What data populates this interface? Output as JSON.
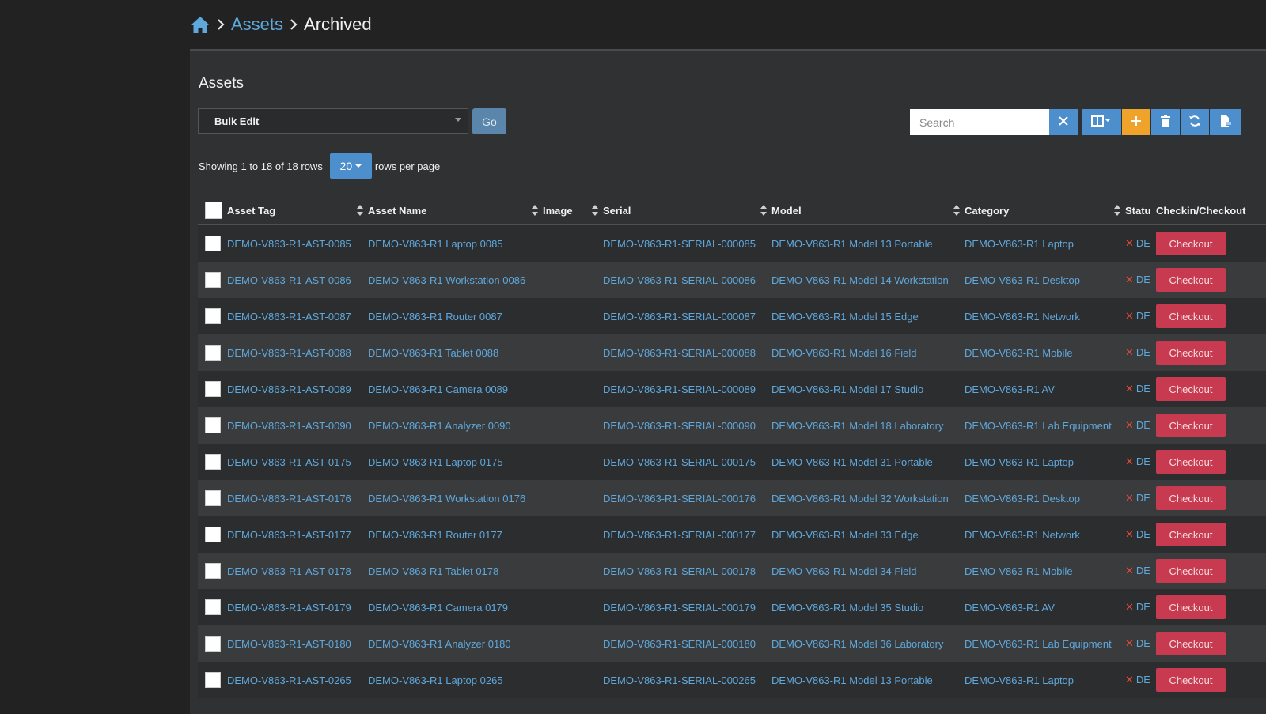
{
  "breadcrumb": {
    "home_icon": "home-icon",
    "items": [
      {
        "label": "Assets",
        "link": true
      },
      {
        "label": "Archived",
        "link": false
      }
    ]
  },
  "panel": {
    "title": "Assets",
    "bulk": {
      "selected": "Bulk Edit",
      "go_label": "Go"
    },
    "search": {
      "placeholder": "Search"
    },
    "toolbar": {
      "clear_icon": "close-icon",
      "columns_icon": "columns-icon",
      "add_icon": "plus-icon",
      "delete_icon": "trash-icon",
      "refresh_icon": "refresh-icon",
      "export_icon": "export-file-icon"
    },
    "pager": {
      "showing": "Showing 1 to 18 of 18 rows",
      "per_page_value": "20",
      "per_page_suffix": "rows per page"
    },
    "colors": {
      "link": "#5fa8dc",
      "accent": "#4d8fcd",
      "warning": "#f0a32a",
      "danger": "#c83a4f"
    }
  },
  "table": {
    "columns": [
      "Asset Tag",
      "Asset Name",
      "Image",
      "Serial",
      "Model",
      "Category",
      "Statu",
      "Checkin/Checkout"
    ],
    "status_label": "DE",
    "checkout_label": "Checkout",
    "rows": [
      {
        "tag": "DEMO-V863-R1-AST-0085",
        "name": "DEMO-V863-R1 Laptop 0085",
        "serial": "DEMO-V863-R1-SERIAL-000085",
        "model": "DEMO-V863-R1 Model 13 Portable",
        "category": "DEMO-V863-R1 Laptop"
      },
      {
        "tag": "DEMO-V863-R1-AST-0086",
        "name": "DEMO-V863-R1 Workstation 0086",
        "serial": "DEMO-V863-R1-SERIAL-000086",
        "model": "DEMO-V863-R1 Model 14 Workstation",
        "category": "DEMO-V863-R1 Desktop"
      },
      {
        "tag": "DEMO-V863-R1-AST-0087",
        "name": "DEMO-V863-R1 Router 0087",
        "serial": "DEMO-V863-R1-SERIAL-000087",
        "model": "DEMO-V863-R1 Model 15 Edge",
        "category": "DEMO-V863-R1 Network"
      },
      {
        "tag": "DEMO-V863-R1-AST-0088",
        "name": "DEMO-V863-R1 Tablet 0088",
        "serial": "DEMO-V863-R1-SERIAL-000088",
        "model": "DEMO-V863-R1 Model 16 Field",
        "category": "DEMO-V863-R1 Mobile"
      },
      {
        "tag": "DEMO-V863-R1-AST-0089",
        "name": "DEMO-V863-R1 Camera 0089",
        "serial": "DEMO-V863-R1-SERIAL-000089",
        "model": "DEMO-V863-R1 Model 17 Studio",
        "category": "DEMO-V863-R1 AV"
      },
      {
        "tag": "DEMO-V863-R1-AST-0090",
        "name": "DEMO-V863-R1 Analyzer 0090",
        "serial": "DEMO-V863-R1-SERIAL-000090",
        "model": "DEMO-V863-R1 Model 18 Laboratory",
        "category": "DEMO-V863-R1 Lab Equipment"
      },
      {
        "tag": "DEMO-V863-R1-AST-0175",
        "name": "DEMO-V863-R1 Laptop 0175",
        "serial": "DEMO-V863-R1-SERIAL-000175",
        "model": "DEMO-V863-R1 Model 31 Portable",
        "category": "DEMO-V863-R1 Laptop"
      },
      {
        "tag": "DEMO-V863-R1-AST-0176",
        "name": "DEMO-V863-R1 Workstation 0176",
        "serial": "DEMO-V863-R1-SERIAL-000176",
        "model": "DEMO-V863-R1 Model 32 Workstation",
        "category": "DEMO-V863-R1 Desktop"
      },
      {
        "tag": "DEMO-V863-R1-AST-0177",
        "name": "DEMO-V863-R1 Router 0177",
        "serial": "DEMO-V863-R1-SERIAL-000177",
        "model": "DEMO-V863-R1 Model 33 Edge",
        "category": "DEMO-V863-R1 Network"
      },
      {
        "tag": "DEMO-V863-R1-AST-0178",
        "name": "DEMO-V863-R1 Tablet 0178",
        "serial": "DEMO-V863-R1-SERIAL-000178",
        "model": "DEMO-V863-R1 Model 34 Field",
        "category": "DEMO-V863-R1 Mobile"
      },
      {
        "tag": "DEMO-V863-R1-AST-0179",
        "name": "DEMO-V863-R1 Camera 0179",
        "serial": "DEMO-V863-R1-SERIAL-000179",
        "model": "DEMO-V863-R1 Model 35 Studio",
        "category": "DEMO-V863-R1 AV"
      },
      {
        "tag": "DEMO-V863-R1-AST-0180",
        "name": "DEMO-V863-R1 Analyzer 0180",
        "serial": "DEMO-V863-R1-SERIAL-000180",
        "model": "DEMO-V863-R1 Model 36 Laboratory",
        "category": "DEMO-V863-R1 Lab Equipment"
      },
      {
        "tag": "DEMO-V863-R1-AST-0265",
        "name": "DEMO-V863-R1 Laptop 0265",
        "serial": "DEMO-V863-R1-SERIAL-000265",
        "model": "DEMO-V863-R1 Model 13 Portable",
        "category": "DEMO-V863-R1 Laptop"
      }
    ]
  }
}
